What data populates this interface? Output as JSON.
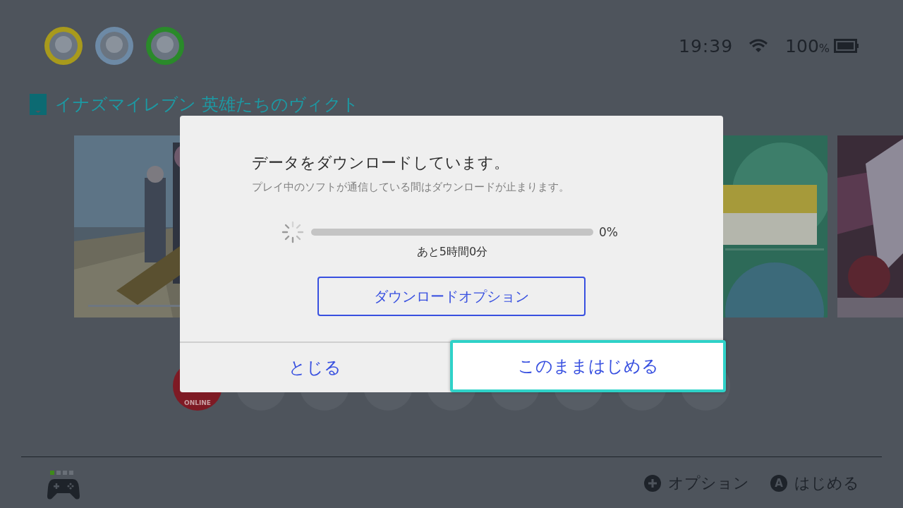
{
  "users": [
    {
      "color": "#a89a1c"
    },
    {
      "color": "#6d8aa6"
    },
    {
      "color": "#2a8a2a"
    }
  ],
  "status": {
    "time": "19:39",
    "battery": "100",
    "battery_unit": "%"
  },
  "game_title": "イナズマイレブン 英雄たちのヴィクト",
  "online_label": "ONLINE",
  "dialog": {
    "title": "データをダウンロードしています。",
    "message": "プレイ中のソフトが通信している間はダウンロードが止まります。",
    "progress": {
      "level": 0,
      "percent": "0%",
      "remaining": "あと5時間0分"
    },
    "option_button": "ダウンロードオプション",
    "buttons": [
      {
        "label": "とじる",
        "selected": false
      },
      {
        "label": "このままはじめる",
        "selected": true
      }
    ]
  },
  "player_lamps": [
    {
      "on": true
    },
    {
      "on": false
    },
    {
      "on": false
    },
    {
      "on": false
    }
  ],
  "hints": [
    {
      "kind": "plus",
      "label": "オプション"
    },
    {
      "kind": "key",
      "key": "A",
      "label": "はじめる"
    }
  ]
}
